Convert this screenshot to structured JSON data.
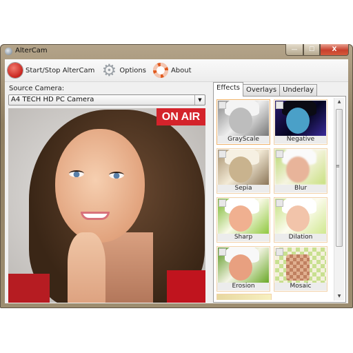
{
  "window": {
    "title": "AlterCam",
    "controls": {
      "minimize": "—",
      "maximize": "☐",
      "close": "X"
    }
  },
  "toolbar": {
    "items": [
      {
        "label": "Start/Stop AlterCam",
        "icon": "record-icon"
      },
      {
        "label": "Options",
        "icon": "gear-icon"
      },
      {
        "label": "About",
        "icon": "lifebuoy-icon"
      }
    ]
  },
  "source": {
    "label": "Source Camera:",
    "selected": "A4 TECH HD PC Camera"
  },
  "preview": {
    "badge": "ON AIR",
    "badge_color": "#d4232b"
  },
  "tabs": [
    {
      "label": "Effects",
      "active": true
    },
    {
      "label": "Overlays",
      "active": false
    },
    {
      "label": "Underlay",
      "active": false
    }
  ],
  "effects": [
    {
      "name": "GrayScale",
      "selected": true
    },
    {
      "name": "Negative",
      "selected": false
    },
    {
      "name": "Sepia",
      "selected": false
    },
    {
      "name": "Blur",
      "selected": false
    },
    {
      "name": "Sharp",
      "selected": false
    },
    {
      "name": "Dilation",
      "selected": false
    },
    {
      "name": "Erosion",
      "selected": false
    },
    {
      "name": "Mosaic",
      "selected": false
    }
  ]
}
